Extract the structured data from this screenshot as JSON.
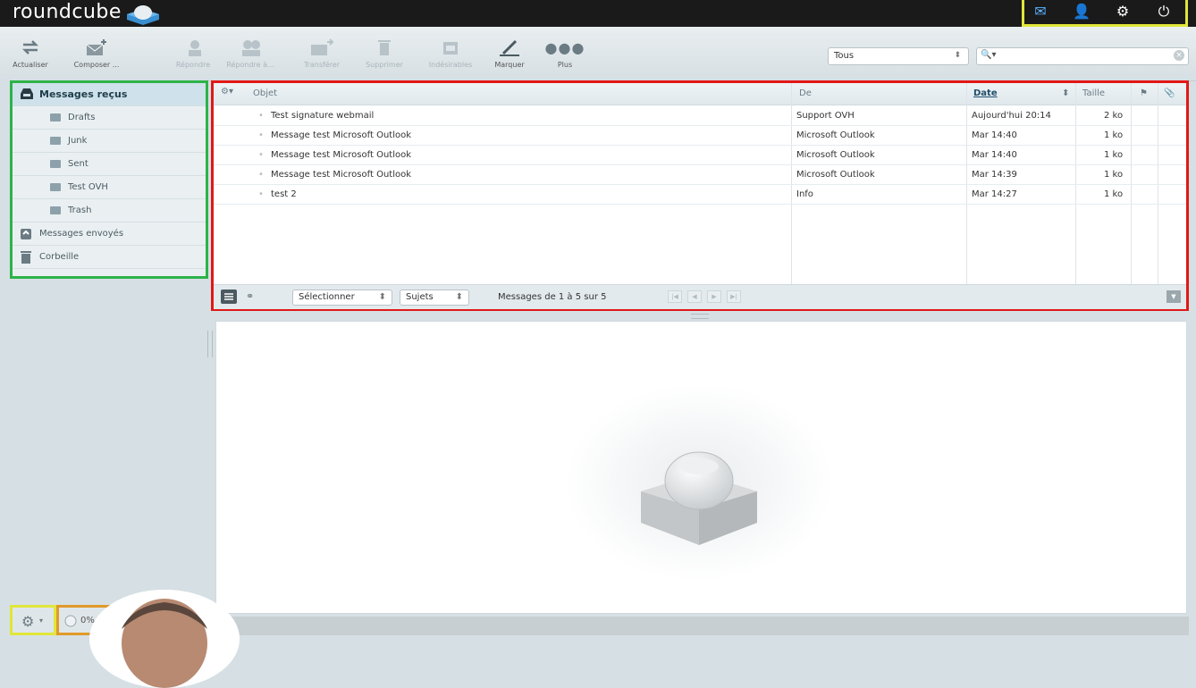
{
  "app": {
    "logo": "roundcube"
  },
  "toolbar": {
    "buttons": [
      {
        "label": "Actualiser",
        "icon": "refresh-icon"
      },
      {
        "label": "Composer ...",
        "icon": "compose-icon"
      },
      {
        "label": "Répondre",
        "icon": "reply-icon"
      },
      {
        "label": "Répondre à...",
        "icon": "reply-all-icon"
      },
      {
        "label": "Transférer",
        "icon": "forward-icon"
      },
      {
        "label": "Supprimer",
        "icon": "trash-icon"
      },
      {
        "label": "Indésirables",
        "icon": "spam-icon"
      },
      {
        "label": "Marquer",
        "icon": "mark-icon"
      },
      {
        "label": "Plus",
        "icon": "more-icon"
      }
    ],
    "filter": {
      "value": "Tous"
    },
    "search": {
      "value": ""
    }
  },
  "folders": [
    {
      "label": "Messages reçus",
      "icon": "inbox-icon"
    },
    {
      "label": "Drafts",
      "icon": "folder-icon"
    },
    {
      "label": "Junk",
      "icon": "folder-icon"
    },
    {
      "label": "Sent",
      "icon": "folder-icon"
    },
    {
      "label": "Test OVH",
      "icon": "folder-icon"
    },
    {
      "label": "Trash",
      "icon": "folder-icon"
    },
    {
      "label": "Messages envoyés",
      "icon": "sent-icon"
    },
    {
      "label": "Corbeille",
      "icon": "trash-icon"
    }
  ],
  "messagelist": {
    "columns": {
      "subject": "Objet",
      "from": "De",
      "date": "Date",
      "size": "Taille"
    },
    "rows": [
      {
        "subject": "Test signature webmail",
        "from": "Support OVH",
        "date": "Aujourd'hui 20:14",
        "size": "2 ko"
      },
      {
        "subject": "Message test Microsoft Outlook",
        "from": "Microsoft Outlook",
        "date": "Mar 14:40",
        "size": "1 ko"
      },
      {
        "subject": "Message test Microsoft Outlook",
        "from": "Microsoft Outlook",
        "date": "Mar 14:40",
        "size": "1 ko"
      },
      {
        "subject": "Message test Microsoft Outlook",
        "from": "Microsoft Outlook",
        "date": "Mar 14:39",
        "size": "1 ko"
      },
      {
        "subject": "test 2",
        "from": "Info",
        "date": "Mar 14:27",
        "size": "1 ko"
      }
    ],
    "footer": {
      "select_label": "Sélectionner",
      "threads_label": "Sujets",
      "count_text": "Messages de 1 à 5 sur 5"
    }
  },
  "quota": {
    "text": "0%"
  },
  "colors": {
    "folder_border": "#2db34a",
    "list_border": "#e11818",
    "top_border": "#e0e63a",
    "quota_border": "#e09a2a"
  }
}
